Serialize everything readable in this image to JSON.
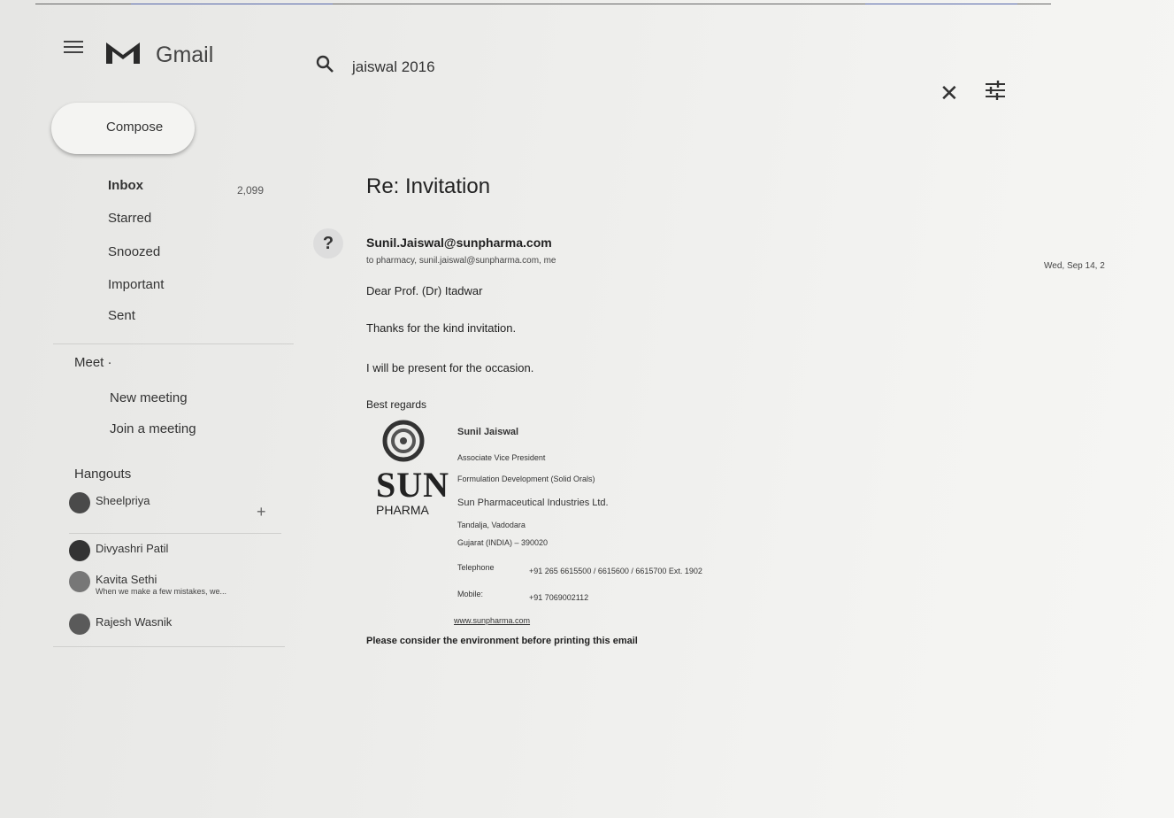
{
  "app": {
    "title": "Gmail"
  },
  "search": {
    "query": "jaiswal 2016"
  },
  "compose": {
    "label": "Compose"
  },
  "nav": {
    "inbox": "Inbox",
    "inbox_count": "2,099",
    "starred": "Starred",
    "snoozed": "Snoozed",
    "important": "Important",
    "sent": "Sent"
  },
  "meet": {
    "title": "Meet ·",
    "new_meeting": "New meeting",
    "join_meeting": "Join a meeting"
  },
  "hangouts": {
    "title": "Hangouts",
    "contacts": [
      {
        "name": "Sheelpriya",
        "sub": ""
      },
      {
        "name": "Divyashri Patil",
        "sub": ""
      },
      {
        "name": "Kavita Sethi",
        "sub": "When we make a few mistakes, we..."
      },
      {
        "name": "Rajesh Wasnik",
        "sub": ""
      }
    ]
  },
  "message": {
    "subject": "Re: Invitation",
    "sender": "Sunil.Jaiswal@sunpharma.com",
    "to": "to pharmacy, sunil.jaiswal@sunpharma.com, me",
    "date": "Wed, Sep 14, 2",
    "greeting": "Dear Prof. (Dr) Itadwar",
    "line1": "Thanks for the kind invitation.",
    "line2": "I will be present for the occasion.",
    "closing": "Best regards",
    "footer": "Please consider the environment before printing this email"
  },
  "signature": {
    "logo_sun": "SUN",
    "logo_pharma": "PHARMA",
    "name": "Sunil Jaiswal",
    "title": "Associate Vice President",
    "dept": "Formulation Development (Solid Orals)",
    "company": "Sun Pharmaceutical Industries Ltd.",
    "address1": "Tandalja, Vadodara",
    "address2": "Gujarat (INDIA) – 390020",
    "tel_label": "Telephone",
    "tel_value": "+91 265 6615500 / 6615600 / 6615700 Ext. 1902",
    "mob_label": "Mobile:",
    "mob_value": "+91 7069002112",
    "website": "www.sunpharma.com"
  },
  "colors": {
    "background": "#ececea",
    "text": "#222222",
    "compose_bg": "#f4f4f2"
  }
}
